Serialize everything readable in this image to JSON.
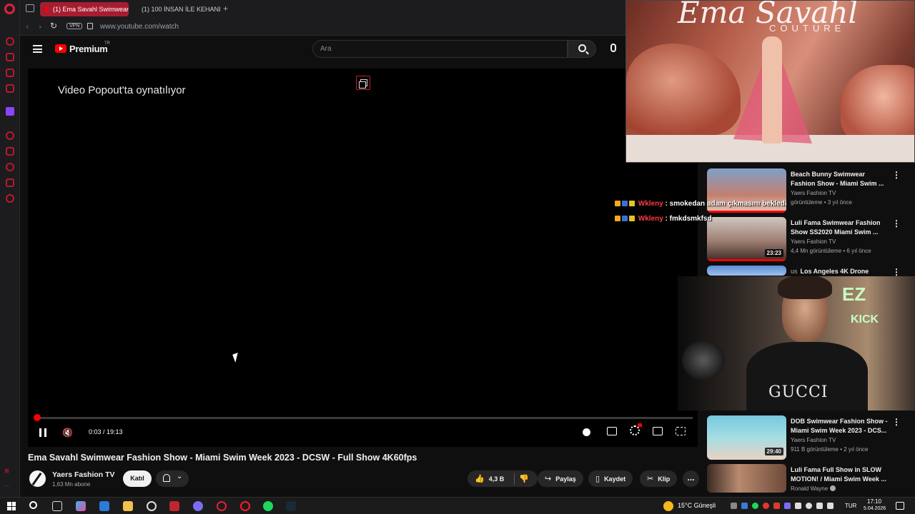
{
  "browser": {
    "tabs": [
      {
        "label": "(1) Ema Savahl Swimwear",
        "active": true
      },
      {
        "label": "(1) 100 İNSAN İLE KEHANE",
        "active": false
      }
    ],
    "new_tab": "+",
    "vpn_badge": "VPN",
    "url": "www.youtube.com/watch",
    "accent_color": "#a71d30"
  },
  "youtube": {
    "logo_text": "Premium",
    "logo_country": "TR",
    "search_placeholder": "Ara"
  },
  "player": {
    "popout_message": "Video Popout'ta oynatılıyor",
    "current_time": "0:03",
    "duration": "19:13",
    "time_display": "0:03 / 19:13",
    "progress_fraction": 0.0026
  },
  "video": {
    "title": "Ema Savahl Swimwear Fashion Show - Miami Swim Week 2023 - DCSW - Full Show 4K60fps",
    "channel": "Yaers Fashion TV",
    "subscribers": "1,63 Mn abone",
    "join_label": "Katıl",
    "likes": "4,3 B",
    "share_label": "Paylaş",
    "save_label": "Kaydet",
    "clip_label": "Klip",
    "more_label": "..."
  },
  "popout_video": {
    "brand": "Ema Savahl",
    "brand_sub": "COUTURE"
  },
  "chat": [
    {
      "user": "Wkleny",
      "message": ": smokedan adam çıkmasını bekledi"
    },
    {
      "user": "Wkleny",
      "message": ": fmkdsmkfsd"
    }
  ],
  "webcam": {
    "shirt_text": "GUCCI",
    "sign_top": "EZ",
    "sign_bottom": "KICK"
  },
  "related": [
    {
      "title": "Beach Bunny Swimwear Fashion Show - Miami Swim ...",
      "channel": "Yaers Fashion TV",
      "meta": "görüntüleme • 3 yıl önce",
      "duration": ""
    },
    {
      "title": "Luli Fama Swimwear Fashion Show SS2020 Miami Swim ...",
      "channel": "Yaers Fashion TV",
      "meta": "4,4 Mn görüntüleme • 6 yıl önce",
      "duration": "23:23"
    },
    {
      "title": "Los Angeles 4K Drone",
      "channel": "",
      "meta": "",
      "duration": "",
      "prefix": "us"
    },
    {
      "title": "DOB Swimwear Fashion Show - Miami Swim Week 2023 - DCS...",
      "channel": "Yaers Fashion TV",
      "meta": "911 B görüntüleme • 2 yıl önce",
      "duration": "29:40"
    },
    {
      "title": "Luli Fama Full Show in SLOW MOTION! / Miami Swim Week ...",
      "channel": "Ronald Wayne",
      "meta": "",
      "duration": ""
    }
  ],
  "taskbar": {
    "weather": "15°C Güneşli",
    "language": "TUR",
    "time": "17:10",
    "date": "5.04.2026"
  }
}
